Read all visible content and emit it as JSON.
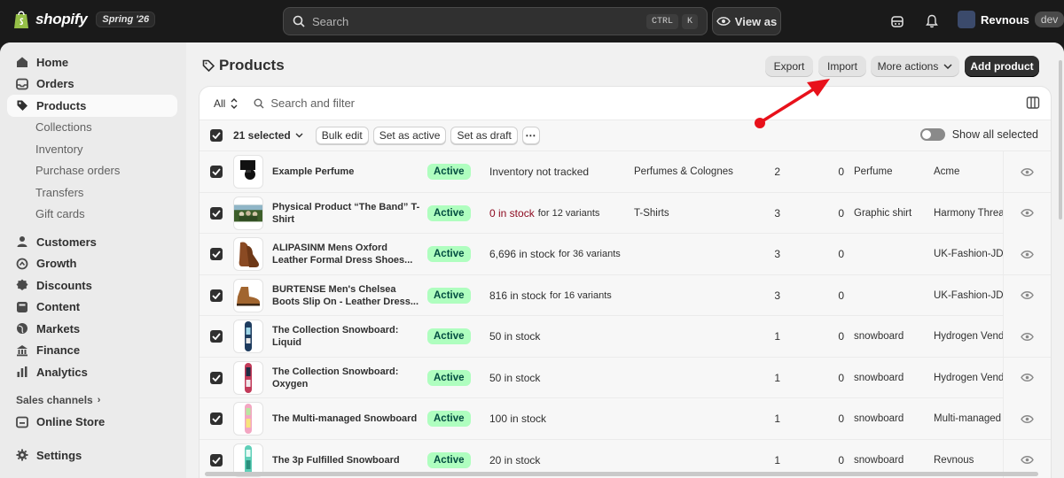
{
  "topbar": {
    "brand": "shopify",
    "season": "Spring '26",
    "search_placeholder": "Search",
    "shortcut_keys": [
      "CTRL",
      "K"
    ],
    "view_as": "View as",
    "user_name": "Revnous",
    "user_badge": "dev"
  },
  "sidebar": {
    "items": [
      {
        "label": "Home",
        "icon": "home-icon"
      },
      {
        "label": "Orders",
        "icon": "inbox-icon"
      },
      {
        "label": "Products",
        "icon": "tag-icon",
        "active": true
      },
      {
        "label": "Collections",
        "sub": true
      },
      {
        "label": "Inventory",
        "sub": true
      },
      {
        "label": "Purchase orders",
        "sub": true
      },
      {
        "label": "Transfers",
        "sub": true
      },
      {
        "label": "Gift cards",
        "sub": true
      },
      {
        "label": "Customers",
        "icon": "person-icon"
      },
      {
        "label": "Growth",
        "icon": "growth-icon"
      },
      {
        "label": "Discounts",
        "icon": "discount-icon"
      },
      {
        "label": "Content",
        "icon": "content-icon"
      },
      {
        "label": "Markets",
        "icon": "globe-icon"
      },
      {
        "label": "Finance",
        "icon": "bank-icon"
      },
      {
        "label": "Analytics",
        "icon": "chart-icon"
      }
    ],
    "sales_channels_label": "Sales channels",
    "online_store": "Online Store",
    "settings": "Settings"
  },
  "page": {
    "title": "Products",
    "export": "Export",
    "import": "Import",
    "more_actions": "More actions",
    "add_product": "Add product"
  },
  "filters": {
    "view": "All",
    "search_placeholder": "Search and filter"
  },
  "bulk": {
    "selected": "21 selected",
    "bulk_edit": "Bulk edit",
    "set_active": "Set as active",
    "set_draft": "Set as draft",
    "show_all_selected": "Show all selected"
  },
  "products": [
    {
      "name": "Example Perfume",
      "status": "Active",
      "inventory": "Inventory not tracked",
      "inventory_suffix": "",
      "inventory_red": false,
      "category": "Perfumes & Colognes",
      "channels": "2",
      "markets": "0",
      "type": "Perfume",
      "vendor": "Acme",
      "thumb": "perfume"
    },
    {
      "name": "Physical Product “The Band” T-Shirt",
      "status": "Active",
      "inventory": "0 in stock",
      "inventory_suffix": "for 12 variants",
      "inventory_red": true,
      "category": "T-Shirts",
      "channels": "3",
      "markets": "0",
      "type": "Graphic shirt",
      "vendor": "Harmony Threa",
      "thumb": "photo"
    },
    {
      "name": "ALIPASINM Mens Oxford Leather Formal Dress Shoes...",
      "status": "Active",
      "inventory": "6,696 in stock",
      "inventory_suffix": "for 36 variants",
      "inventory_red": false,
      "category": "",
      "channels": "3",
      "markets": "0",
      "type": "",
      "vendor": "UK-Fashion-JD",
      "thumb": "shoe"
    },
    {
      "name": "BURTENSE Men's Chelsea Boots Slip On - Leather Dress...",
      "status": "Active",
      "inventory": "816 in stock",
      "inventory_suffix": "for 16 variants",
      "inventory_red": false,
      "category": "",
      "channels": "3",
      "markets": "0",
      "type": "",
      "vendor": "UK-Fashion-JD",
      "thumb": "boot"
    },
    {
      "name": "The Collection Snowboard: Liquid",
      "status": "Active",
      "inventory": "50 in stock",
      "inventory_suffix": "",
      "inventory_red": false,
      "category": "",
      "channels": "1",
      "markets": "0",
      "type": "snowboard",
      "vendor": "Hydrogen Vend",
      "thumb": "board1"
    },
    {
      "name": "The Collection Snowboard: Oxygen",
      "status": "Active",
      "inventory": "50 in stock",
      "inventory_suffix": "",
      "inventory_red": false,
      "category": "",
      "channels": "1",
      "markets": "0",
      "type": "snowboard",
      "vendor": "Hydrogen Vend",
      "thumb": "board2"
    },
    {
      "name": "The Multi-managed Snowboard",
      "status": "Active",
      "inventory": "100 in stock",
      "inventory_suffix": "",
      "inventory_red": false,
      "category": "",
      "channels": "1",
      "markets": "0",
      "type": "snowboard",
      "vendor": "Multi-managed",
      "thumb": "board3"
    },
    {
      "name": "The 3p Fulfilled Snowboard",
      "status": "Active",
      "inventory": "20 in stock",
      "inventory_suffix": "",
      "inventory_red": false,
      "category": "",
      "channels": "1",
      "markets": "0",
      "type": "snowboard",
      "vendor": "Revnous",
      "thumb": "board4"
    }
  ],
  "colors": {
    "annotation_arrow": "#e8111b",
    "active_badge_bg": "#affebf",
    "active_badge_text": "#014b40",
    "out_of_stock_text": "#8e0b21"
  }
}
